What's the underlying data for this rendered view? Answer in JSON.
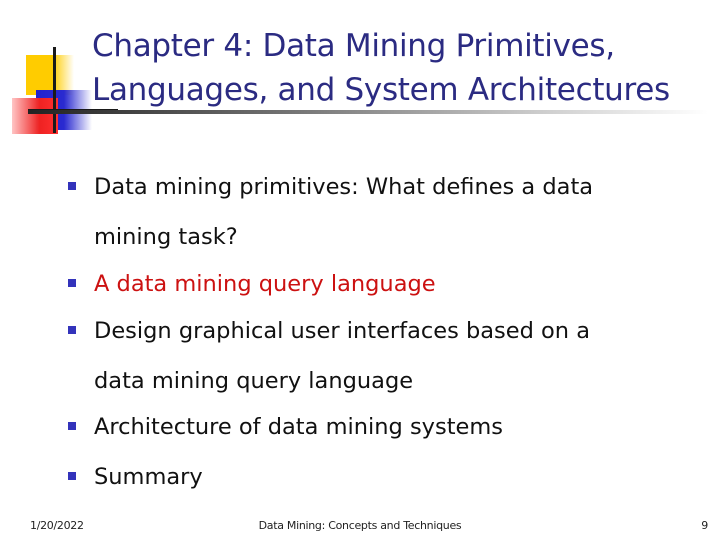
{
  "slide": {
    "title_lines": [
      "Chapter 4: Data Mining Primitives,",
      "Languages, and System Architectures"
    ],
    "bullets": [
      {
        "lines": [
          "Data mining primitives: What defines a data",
          "mining task?"
        ],
        "highlight": false
      },
      {
        "lines": [
          "A data mining query language"
        ],
        "highlight": true
      },
      {
        "lines": [
          "Design graphical user interfaces based on a",
          "data mining query language"
        ],
        "highlight": false
      },
      {
        "lines": [
          "Architecture of data mining systems"
        ],
        "highlight": false
      },
      {
        "lines": [
          "Summary"
        ],
        "highlight": false
      }
    ],
    "colors": {
      "title": "#2b2b82",
      "bullet_marker": "#3333bb",
      "highlight_text": "#cc1111",
      "body_text": "#111111"
    }
  },
  "footer": {
    "date": "1/20/2022",
    "center": "Data Mining: Concepts and Techniques",
    "page_number": "9"
  }
}
